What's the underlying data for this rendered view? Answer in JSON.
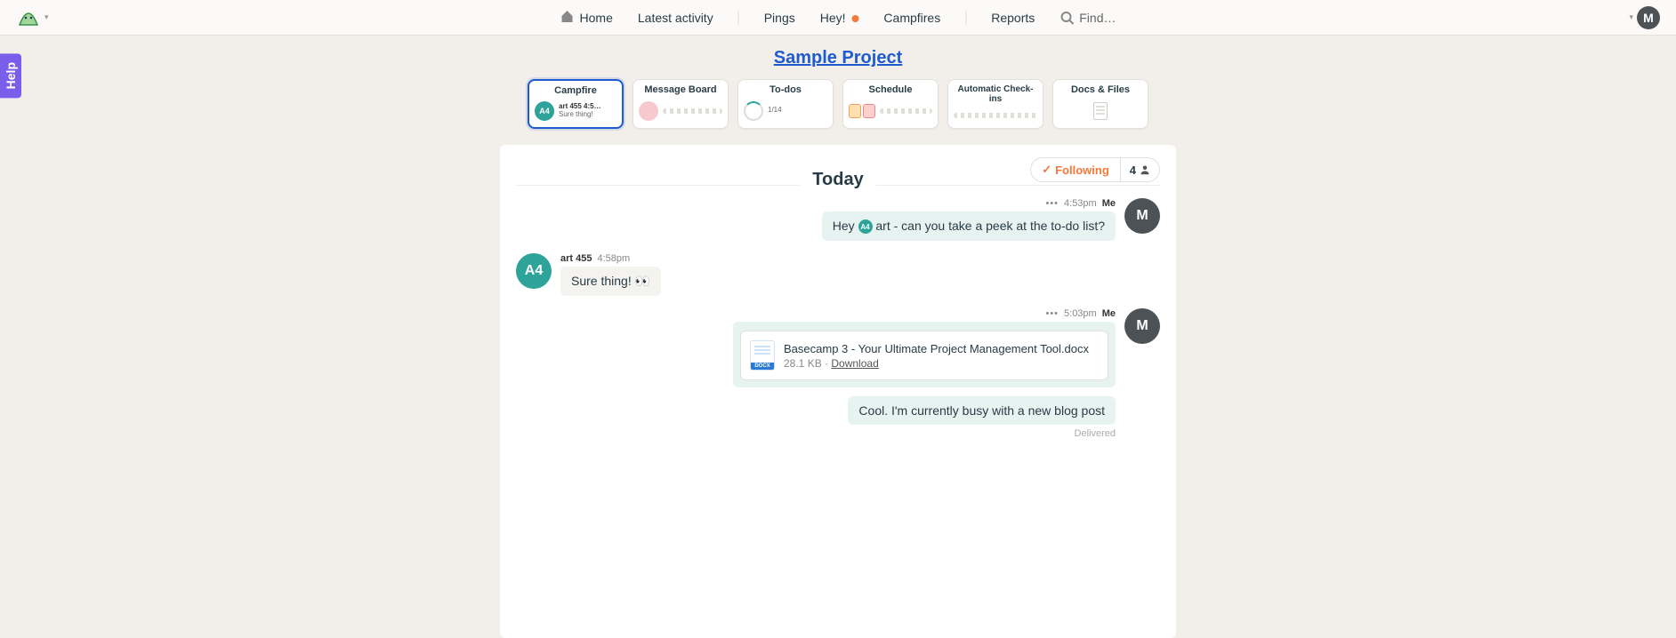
{
  "nav": {
    "home": "Home",
    "latest": "Latest activity",
    "pings": "Pings",
    "hey": "Hey!",
    "campfires": "Campfires",
    "reports": "Reports",
    "find": "Find…"
  },
  "help_label": "Help",
  "user_initial": "M",
  "project": {
    "title": "Sample Project"
  },
  "cards": {
    "campfire": {
      "title": "Campfire",
      "avatar": "A4",
      "line1": "art 455   4:5…",
      "line2": "Sure thing!"
    },
    "message_board": {
      "title": "Message Board"
    },
    "todos": {
      "title": "To-dos",
      "count": "1/14"
    },
    "schedule": {
      "title": "Schedule"
    },
    "checkins": {
      "title": "Automatic Check-ins"
    },
    "docs": {
      "title": "Docs & Files"
    }
  },
  "panel": {
    "today": "Today",
    "following": "Following",
    "people_count": "4"
  },
  "messages": {
    "m1": {
      "time": "4:53pm",
      "sender": "Me",
      "pre": "Hey ",
      "mention_initial": "A4",
      "mention_name": "art",
      "post": "  - can you take a peek at the to-do list?"
    },
    "m2": {
      "name": "art 455",
      "time": "4:58pm",
      "text": "Sure thing! 👀"
    },
    "m3": {
      "time": "5:03pm",
      "sender": "Me",
      "filename": "Basecamp 3 - Your Ultimate Project Management Tool.docx",
      "filesize": "28.1 KB",
      "sep": " · ",
      "download": "Download",
      "docx_label": "DOCX"
    },
    "m4": {
      "text": "Cool. I'm currently busy with a new blog post",
      "status": "Delivered"
    }
  }
}
